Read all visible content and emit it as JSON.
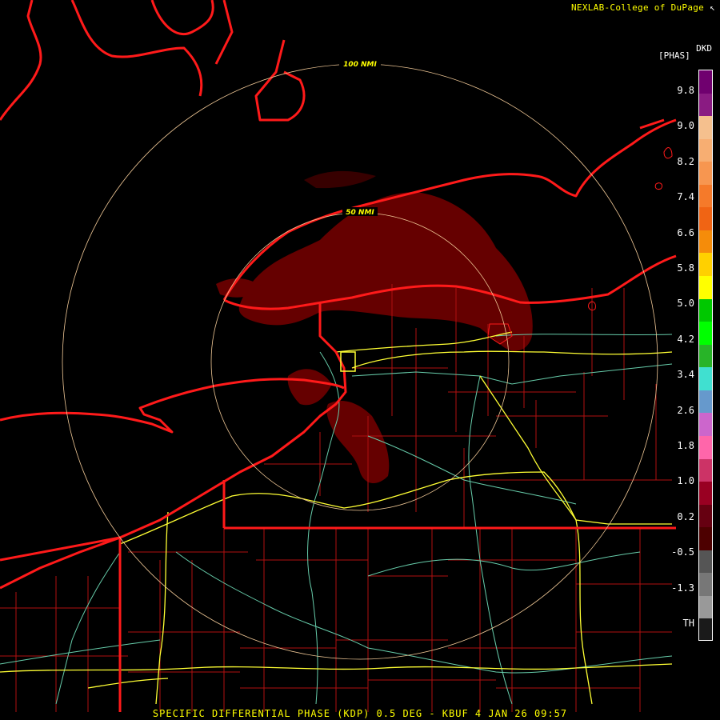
{
  "header": {
    "credit": "NEXLAB-College of DuPage",
    "credit_icon": "nexlab-logo-icon"
  },
  "product": {
    "title": "SPECIFIC DIFFERENTIAL PHASE (KDP) 0.5 DEG - KBUF 4 JAN 26 09:57",
    "radar_site": "KBUF",
    "product_name": "SPECIFIC DIFFERENTIAL PHASE (KDP)",
    "elevation": "0.5 DEG",
    "date": "4 JAN 26",
    "time": "09:57"
  },
  "range_rings": [
    {
      "label": "50 NMI",
      "range_nmi": 50
    },
    {
      "label": "100 NMI",
      "range_nmi": 100
    }
  ],
  "legend": {
    "unit_code": "DKD",
    "unit_label": "[PHAS]",
    "ticks": [
      "9.8",
      "9.0",
      "8.2",
      "7.4",
      "6.6",
      "5.8",
      "5.0",
      "4.2",
      "3.4",
      "2.6",
      "1.8",
      "1.0",
      "0.2",
      "-0.5",
      "-1.3",
      "TH"
    ],
    "colors": [
      "#70006f",
      "#8a1b82",
      "#f5c08e",
      "#f7ae72",
      "#f79650",
      "#f57a2a",
      "#f06414",
      "#f58c0a",
      "#ffd000",
      "#ffff00",
      "#00c800",
      "#00ff00",
      "#28b428",
      "#40e0d0",
      "#6699cc",
      "#cc66cc",
      "#ff66aa",
      "#cc3366",
      "#990022",
      "#660011",
      "#4d0000",
      "#555555",
      "#777777",
      "#999999",
      "#1a1a1a"
    ]
  },
  "map_colors": {
    "background": "#000000",
    "coastlines": "#ff1a1a",
    "county_lines": "#b01010",
    "interstates": "#ffff33",
    "highways": "#66ccaa",
    "range_rings": "#f0c896",
    "echo": "#6e0000"
  }
}
